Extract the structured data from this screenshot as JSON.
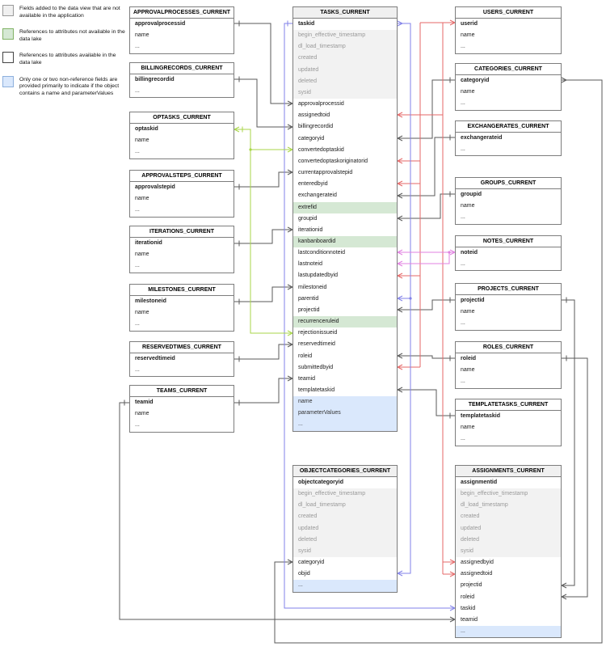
{
  "legend": {
    "items": [
      {
        "swatch": "gray",
        "text": "Fields added to the data view that are not available in the application"
      },
      {
        "swatch": "green",
        "text": "References to attributes not available in the data lake"
      },
      {
        "swatch": "white",
        "text": "References to attributes available in the data lake"
      },
      {
        "swatch": "blue",
        "text": "Only one or two non-reference fields are provided primarily to indicate if the object contains a name and parameterValues"
      }
    ]
  },
  "colors": {
    "black": "#5a5a5a",
    "red": "#e46767",
    "blue": "#8282e8",
    "pink": "#e080e0",
    "green": "#a8d648",
    "row_gray": "#f2f2f2",
    "row_green": "#d5e8d4",
    "row_blue": "#dae8fc",
    "header_gray": "#f0f0f0",
    "table_border": "#7d7d7d",
    "legend_gray": "#f0f0f0",
    "legend_green": "#d5e8d4",
    "legend_white": "#ffffff",
    "legend_blue": "#dae8fc"
  },
  "tables": [
    {
      "id": "approvalprocesses",
      "title": "APPROVALPROCESSES_CURRENT",
      "fields": [
        {
          "n": "approvalprocessid",
          "s": "pk"
        },
        {
          "n": "name",
          "s": "plain"
        },
        {
          "n": "...",
          "s": "plain"
        }
      ]
    },
    {
      "id": "billingrecords",
      "title": "BILLINGRECORDS_CURRENT",
      "fields": [
        {
          "n": "billingrecordid",
          "s": "pk"
        },
        {
          "n": "...",
          "s": "plain"
        }
      ]
    },
    {
      "id": "optasks",
      "title": "OPTASKS_CURRENT",
      "fields": [
        {
          "n": "optaskid",
          "s": "pk"
        },
        {
          "n": "name",
          "s": "plain"
        },
        {
          "n": "...",
          "s": "plain"
        }
      ]
    },
    {
      "id": "approvalsteps",
      "title": "APPROVALSTEPS_CURRENT",
      "fields": [
        {
          "n": "approvalstepid",
          "s": "pk"
        },
        {
          "n": "name",
          "s": "plain"
        },
        {
          "n": "...",
          "s": "plain"
        }
      ]
    },
    {
      "id": "iterations",
      "title": "ITERATIONS_CURRENT",
      "fields": [
        {
          "n": "iterationid",
          "s": "pk"
        },
        {
          "n": "name",
          "s": "plain"
        },
        {
          "n": "...",
          "s": "plain"
        }
      ]
    },
    {
      "id": "milestones",
      "title": "MILESTONES_CURRENT",
      "fields": [
        {
          "n": "milestoneid",
          "s": "pk"
        },
        {
          "n": "name",
          "s": "plain"
        },
        {
          "n": "...",
          "s": "plain"
        }
      ]
    },
    {
      "id": "reservedtimes",
      "title": "RESERVEDTIMES_CURRENT",
      "fields": [
        {
          "n": "reservedtimeid",
          "s": "pk"
        },
        {
          "n": "...",
          "s": "plain"
        }
      ]
    },
    {
      "id": "teams",
      "title": "TEAMS_CURRENT",
      "fields": [
        {
          "n": "teamid",
          "s": "pk"
        },
        {
          "n": "name",
          "s": "plain"
        },
        {
          "n": "...",
          "s": "plain"
        }
      ]
    },
    {
      "id": "tasks",
      "title": "TASKS_CURRENT",
      "fields": [
        {
          "n": "taskid",
          "s": "pk"
        },
        {
          "n": "begin_effective_timestamp",
          "s": "sys"
        },
        {
          "n": "dl_load_timestamp",
          "s": "sys"
        },
        {
          "n": "created",
          "s": "sys"
        },
        {
          "n": "updated",
          "s": "sys"
        },
        {
          "n": "deleted",
          "s": "sys"
        },
        {
          "n": "sysid",
          "s": "sys"
        },
        {
          "n": "approvalprocessid",
          "s": "plain"
        },
        {
          "n": "assignedtoid",
          "s": "plain"
        },
        {
          "n": "billingrecordid",
          "s": "plain"
        },
        {
          "n": "categoryid",
          "s": "plain"
        },
        {
          "n": "convertedoptaskid",
          "s": "plain"
        },
        {
          "n": "convertedoptaskoriginatorid",
          "s": "plain"
        },
        {
          "n": "currentapprovalstepid",
          "s": "plain"
        },
        {
          "n": "enteredbyid",
          "s": "plain"
        },
        {
          "n": "exchangerateid",
          "s": "plain"
        },
        {
          "n": "extrefid",
          "s": "green"
        },
        {
          "n": "groupid",
          "s": "plain"
        },
        {
          "n": "iterationid",
          "s": "plain"
        },
        {
          "n": "kanbanboardid",
          "s": "green"
        },
        {
          "n": "lastconditionnoteid",
          "s": "plain"
        },
        {
          "n": "lastnoteid",
          "s": "plain"
        },
        {
          "n": "lastupdatedbyid",
          "s": "plain"
        },
        {
          "n": "milestoneid",
          "s": "plain"
        },
        {
          "n": "parentid",
          "s": "plain"
        },
        {
          "n": "projectid",
          "s": "plain"
        },
        {
          "n": "recurrenceruleid",
          "s": "green"
        },
        {
          "n": "rejectionissueid",
          "s": "plain"
        },
        {
          "n": "reservedtimeid",
          "s": "plain"
        },
        {
          "n": "roleid",
          "s": "plain"
        },
        {
          "n": "submittedbyid",
          "s": "plain"
        },
        {
          "n": "teamid",
          "s": "plain"
        },
        {
          "n": "templatetaskid",
          "s": "plain"
        },
        {
          "n": "name",
          "s": "blue"
        },
        {
          "n": "parameterValues",
          "s": "blue"
        },
        {
          "n": "...",
          "s": "blue"
        }
      ]
    },
    {
      "id": "users",
      "title": "USERS_CURRENT",
      "fields": [
        {
          "n": "userid",
          "s": "pk"
        },
        {
          "n": "name",
          "s": "plain"
        },
        {
          "n": "...",
          "s": "plain"
        }
      ]
    },
    {
      "id": "categories",
      "title": "CATEGORIES_CURRENT",
      "fields": [
        {
          "n": "categoryid",
          "s": "pk"
        },
        {
          "n": "name",
          "s": "plain"
        },
        {
          "n": "...",
          "s": "plain"
        }
      ]
    },
    {
      "id": "exchangerates",
      "title": "EXCHANGERATES_CURRENT",
      "fields": [
        {
          "n": "exchangerateid",
          "s": "pk"
        },
        {
          "n": "...",
          "s": "plain"
        }
      ]
    },
    {
      "id": "groups",
      "title": "GROUPS_CURRENT",
      "fields": [
        {
          "n": "groupid",
          "s": "pk"
        },
        {
          "n": "name",
          "s": "plain"
        },
        {
          "n": "...",
          "s": "plain"
        }
      ]
    },
    {
      "id": "notes",
      "title": "NOTES_CURRENT",
      "fields": [
        {
          "n": "noteid",
          "s": "pk"
        },
        {
          "n": "...",
          "s": "plain"
        }
      ]
    },
    {
      "id": "projects",
      "title": "PROJECTS_CURRENT",
      "fields": [
        {
          "n": "projectid",
          "s": "pk"
        },
        {
          "n": "name",
          "s": "plain"
        },
        {
          "n": "...",
          "s": "plain"
        }
      ]
    },
    {
      "id": "roles",
      "title": "ROLES_CURRENT",
      "fields": [
        {
          "n": "roleid",
          "s": "pk"
        },
        {
          "n": "name",
          "s": "plain"
        },
        {
          "n": "...",
          "s": "plain"
        }
      ]
    },
    {
      "id": "templatetasks",
      "title": "TEMPLATETASKS_CURRENT",
      "fields": [
        {
          "n": "templatetaskid",
          "s": "pk"
        },
        {
          "n": "name",
          "s": "plain"
        },
        {
          "n": "...",
          "s": "plain"
        }
      ]
    },
    {
      "id": "objectcategories",
      "title": "OBJECTCATEGORIES_CURRENT",
      "fields": [
        {
          "n": "objectcategoryid",
          "s": "pk"
        },
        {
          "n": "begin_effective_timestamp",
          "s": "sys"
        },
        {
          "n": "dl_load_timestamp",
          "s": "sys"
        },
        {
          "n": "created",
          "s": "sys"
        },
        {
          "n": "updated",
          "s": "sys"
        },
        {
          "n": "deleted",
          "s": "sys"
        },
        {
          "n": "sysid",
          "s": "sys"
        },
        {
          "n": "categoryid",
          "s": "plain"
        },
        {
          "n": "objid",
          "s": "plain"
        },
        {
          "n": "...",
          "s": "blue"
        }
      ]
    },
    {
      "id": "assignments",
      "title": "ASSIGNMENTS_CURRENT",
      "fields": [
        {
          "n": "assignmentid",
          "s": "pk"
        },
        {
          "n": "begin_effective_timestamp",
          "s": "sys"
        },
        {
          "n": "dl_load_timestamp",
          "s": "sys"
        },
        {
          "n": "created",
          "s": "sys"
        },
        {
          "n": "updated",
          "s": "sys"
        },
        {
          "n": "deleted",
          "s": "sys"
        },
        {
          "n": "sysid",
          "s": "sys"
        },
        {
          "n": "assignedbyid",
          "s": "plain"
        },
        {
          "n": "assignedtoid",
          "s": "plain"
        },
        {
          "n": "projectid",
          "s": "plain"
        },
        {
          "n": "roleid",
          "s": "plain"
        },
        {
          "n": "taskid",
          "s": "plain"
        },
        {
          "n": "teamid",
          "s": "plain"
        },
        {
          "n": "...",
          "s": "blue"
        }
      ]
    }
  ],
  "relationships": [
    {
      "from": "TASKS_CURRENT.approvalprocessid",
      "to": "APPROVALPROCESSES_CURRENT.approvalprocessid",
      "color": "black"
    },
    {
      "from": "TASKS_CURRENT.billingrecordid",
      "to": "BILLINGRECORDS_CURRENT.billingrecordid",
      "color": "black"
    },
    {
      "from": "TASKS_CURRENT.currentapprovalstepid",
      "to": "APPROVALSTEPS_CURRENT.approvalstepid",
      "color": "black"
    },
    {
      "from": "TASKS_CURRENT.iterationid",
      "to": "ITERATIONS_CURRENT.iterationid",
      "color": "black"
    },
    {
      "from": "TASKS_CURRENT.milestoneid",
      "to": "MILESTONES_CURRENT.milestoneid",
      "color": "black"
    },
    {
      "from": "TASKS_CURRENT.reservedtimeid",
      "to": "RESERVEDTIMES_CURRENT.reservedtimeid",
      "color": "black"
    },
    {
      "from": "TASKS_CURRENT.teamid",
      "to": "TEAMS_CURRENT.teamid",
      "color": "black"
    },
    {
      "from": "TASKS_CURRENT.categoryid",
      "to": "CATEGORIES_CURRENT.categoryid",
      "color": "black"
    },
    {
      "from": "TASKS_CURRENT.exchangerateid",
      "to": "EXCHANGERATES_CURRENT.exchangerateid",
      "color": "black"
    },
    {
      "from": "TASKS_CURRENT.groupid",
      "to": "GROUPS_CURRENT.groupid",
      "color": "black"
    },
    {
      "from": "TASKS_CURRENT.projectid",
      "to": "PROJECTS_CURRENT.projectid",
      "color": "black"
    },
    {
      "from": "TASKS_CURRENT.roleid",
      "to": "ROLES_CURRENT.roleid",
      "color": "black"
    },
    {
      "from": "TASKS_CURRENT.templatetaskid",
      "to": "TEMPLATETASKS_CURRENT.templatetaskid",
      "color": "black"
    },
    {
      "from": "TASKS_CURRENT.convertedoptaskid",
      "to": "OPTASKS_CURRENT.optaskid",
      "color": "green"
    },
    {
      "from": "TASKS_CURRENT.rejectionissueid",
      "to": "OPTASKS_CURRENT.optaskid",
      "color": "green"
    },
    {
      "from": "TASKS_CURRENT.assignedtoid",
      "to": "USERS_CURRENT.userid",
      "color": "red"
    },
    {
      "from": "TASKS_CURRENT.convertedoptaskoriginatorid",
      "to": "USERS_CURRENT.userid",
      "color": "red"
    },
    {
      "from": "TASKS_CURRENT.enteredbyid",
      "to": "USERS_CURRENT.userid",
      "color": "red"
    },
    {
      "from": "TASKS_CURRENT.lastupdatedbyid",
      "to": "USERS_CURRENT.userid",
      "color": "red"
    },
    {
      "from": "TASKS_CURRENT.submittedbyid",
      "to": "USERS_CURRENT.userid",
      "color": "red"
    },
    {
      "from": "TASKS_CURRENT.lastconditionnoteid",
      "to": "NOTES_CURRENT.noteid",
      "color": "pink"
    },
    {
      "from": "TASKS_CURRENT.lastnoteid",
      "to": "NOTES_CURRENT.noteid",
      "color": "pink"
    },
    {
      "from": "TASKS_CURRENT.parentid",
      "to": "TASKS_CURRENT.taskid",
      "color": "blue"
    },
    {
      "from": "OBJECTCATEGORIES_CURRENT.objid",
      "to": "TASKS_CURRENT.taskid",
      "color": "blue"
    },
    {
      "from": "ASSIGNMENTS_CURRENT.taskid",
      "to": "TASKS_CURRENT.taskid",
      "color": "blue"
    },
    {
      "from": "OBJECTCATEGORIES_CURRENT.categoryid",
      "to": "CATEGORIES_CURRENT.categoryid",
      "color": "black"
    },
    {
      "from": "ASSIGNMENTS_CURRENT.projectid",
      "to": "PROJECTS_CURRENT.projectid",
      "color": "black"
    },
    {
      "from": "ASSIGNMENTS_CURRENT.roleid",
      "to": "ROLES_CURRENT.roleid",
      "color": "black"
    },
    {
      "from": "ASSIGNMENTS_CURRENT.teamid",
      "to": "TEAMS_CURRENT.teamid",
      "color": "black"
    },
    {
      "from": "ASSIGNMENTS_CURRENT.assignedbyid",
      "to": "USERS_CURRENT.userid",
      "color": "red"
    },
    {
      "from": "ASSIGNMENTS_CURRENT.assignedtoid",
      "to": "USERS_CURRENT.userid",
      "color": "red"
    }
  ]
}
